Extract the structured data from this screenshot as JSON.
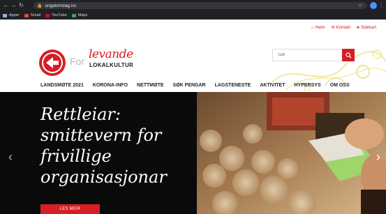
{
  "browser": {
    "url": "ungdomslag.no",
    "bookmarks": [
      {
        "label": "Apper",
        "color": "#8ab4f8"
      },
      {
        "label": "Gmail",
        "color": "#ea4335"
      },
      {
        "label": "YouTube",
        "color": "#ff0000"
      },
      {
        "label": "Maps",
        "color": "#34a853"
      }
    ]
  },
  "topnav": {
    "home": "Heim",
    "contact": "Kontakt",
    "sitemap": "Sidekart"
  },
  "logo": {
    "for": "For",
    "levande": "levande",
    "lokalkultur": "LOKALKULTUR"
  },
  "search": {
    "placeholder": "Søk"
  },
  "mainnav": [
    "LANDSMØTE 2021",
    "KORONA-INFO",
    "NETTMØTE",
    "SØK PENGAR",
    "LAGSTENESTE",
    "AKTIVITET",
    "HYPERSYS",
    "OM OSS"
  ],
  "hero": {
    "title_lines": [
      "Rettleiar:",
      "smittevern for",
      "frivillige",
      "organisasjonar"
    ],
    "read_more": "LES MEIR"
  },
  "colors": {
    "brand_red": "#d61e25",
    "accent_yellow": "#f3e7a3"
  }
}
